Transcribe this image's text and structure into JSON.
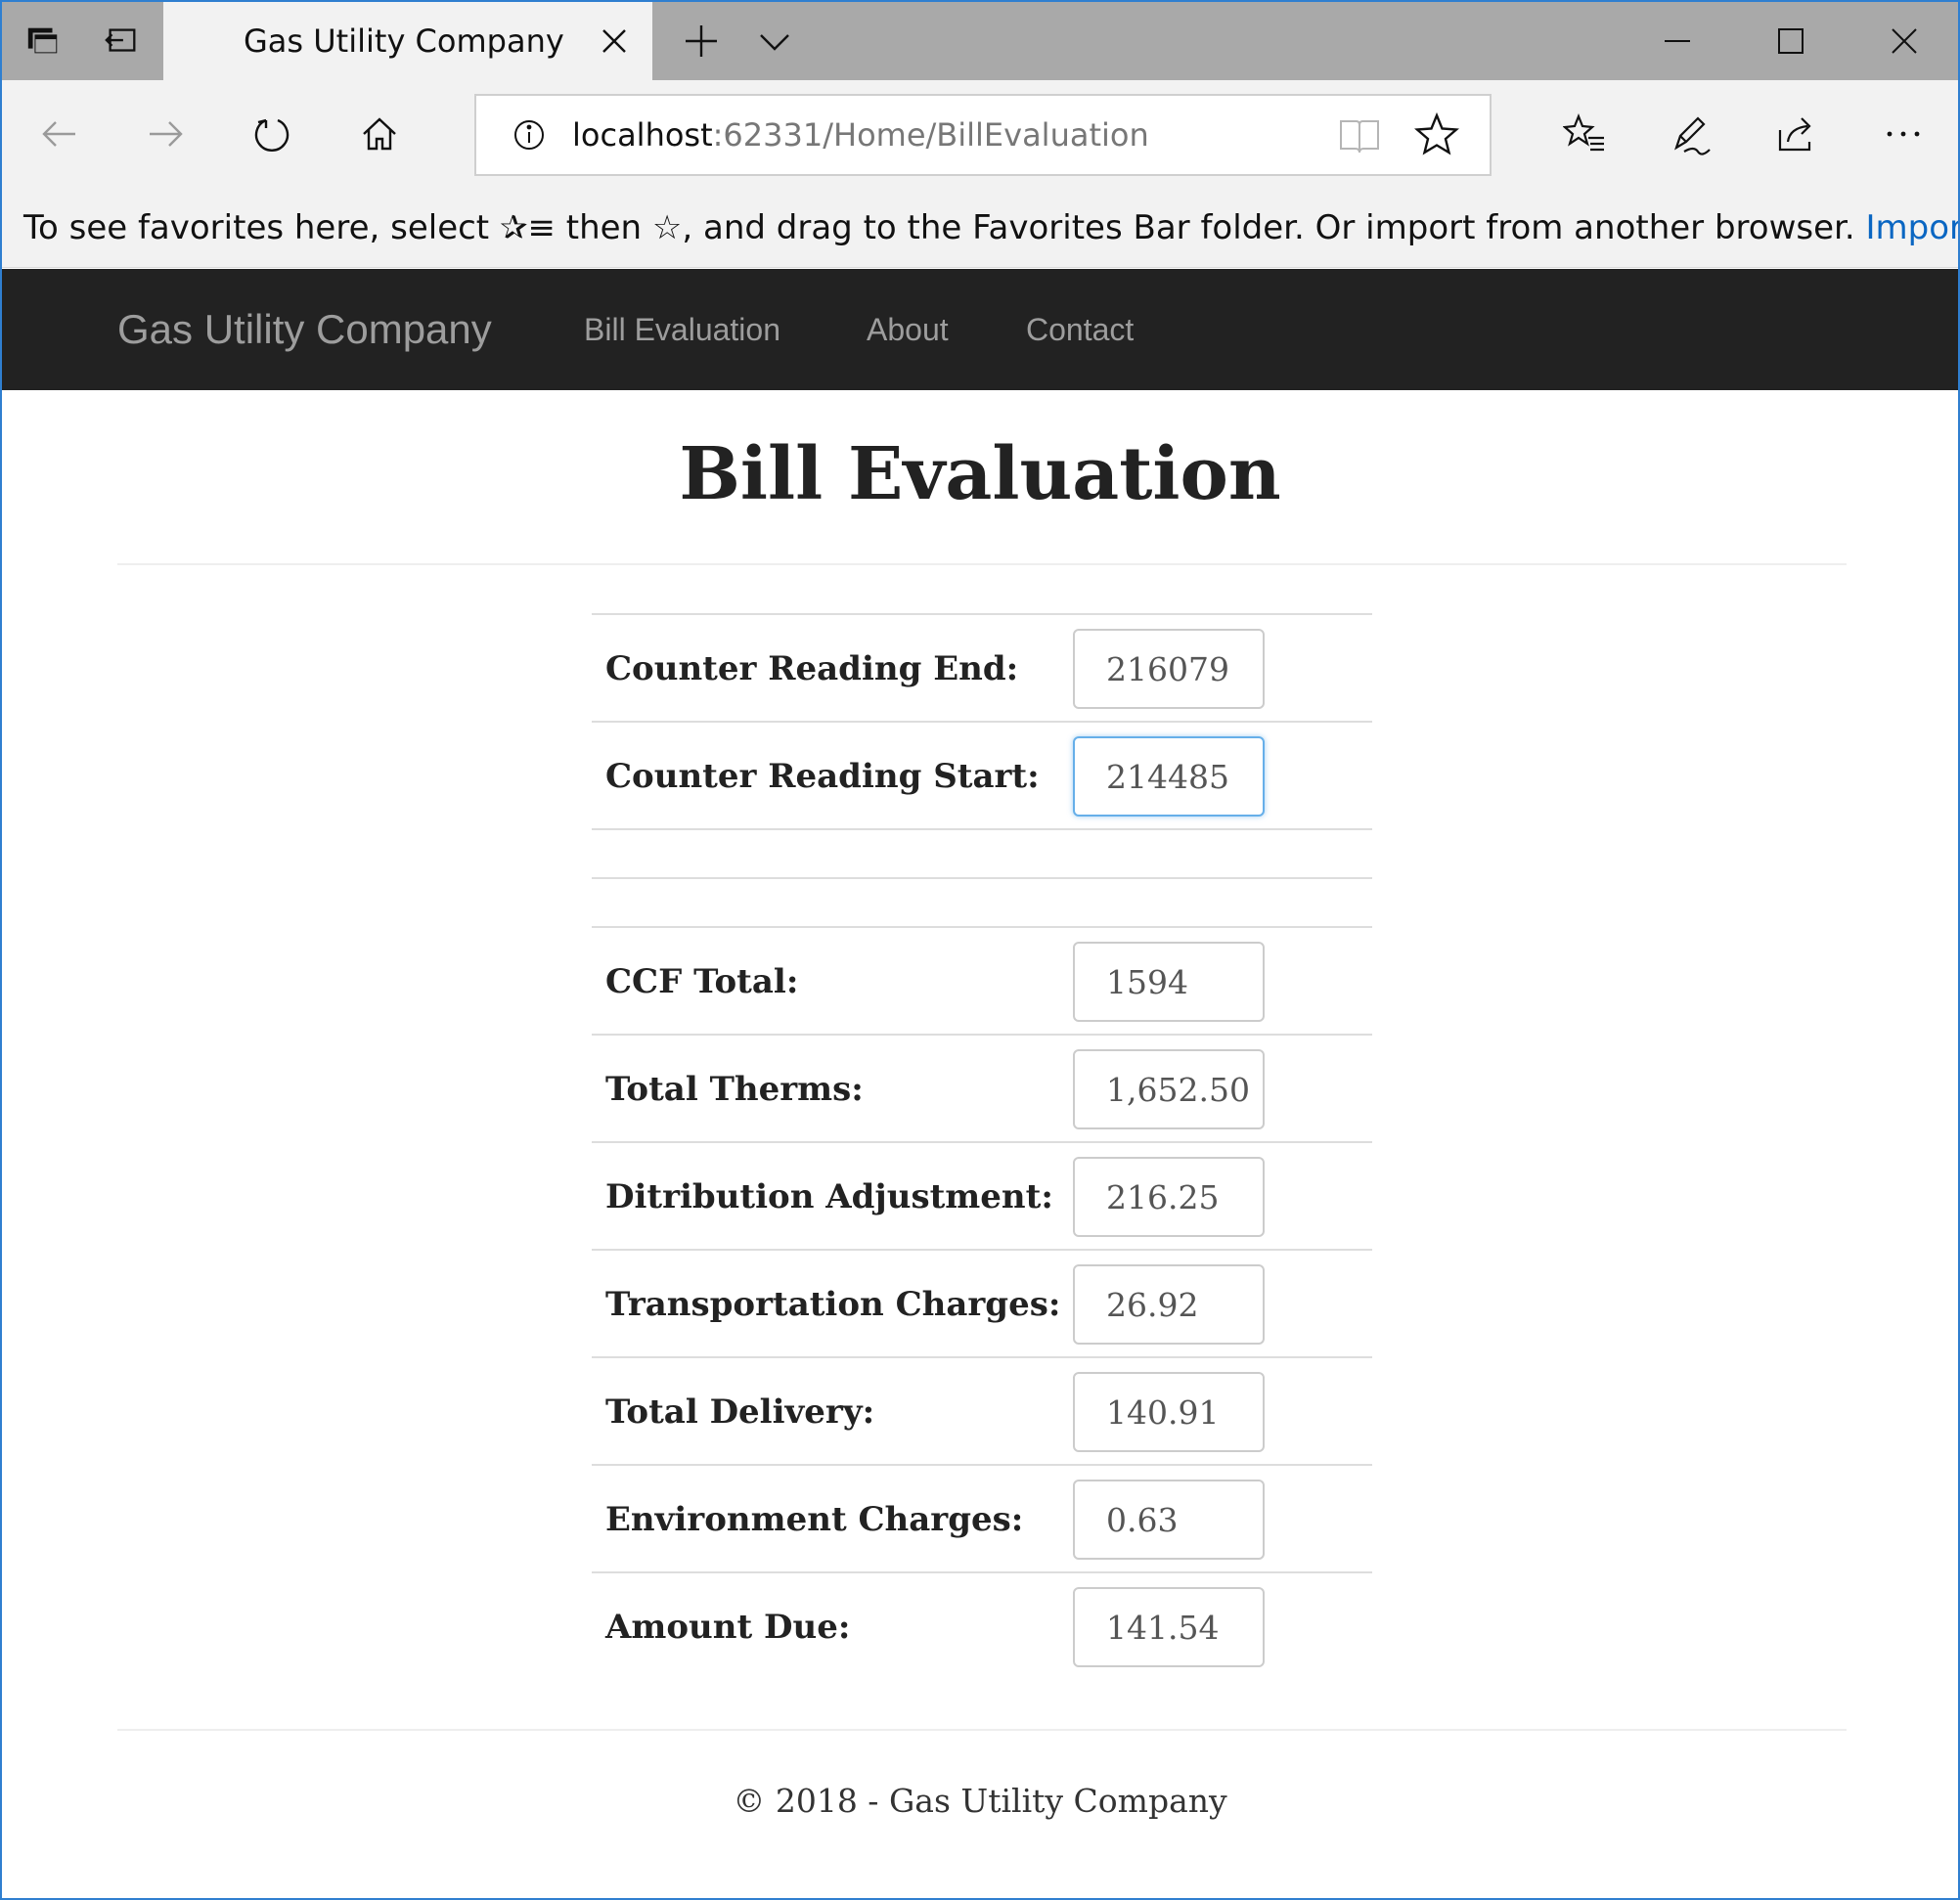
{
  "browser": {
    "tab_title": "Gas Utility Company :: B",
    "address": {
      "host": "localhost",
      "path": ":62331/Home/BillEvaluation"
    },
    "favorites_bar": {
      "text_part1": "To see favorites here, select ",
      "icon_glyph1": "✰≡",
      "text_part2": " then ",
      "icon_glyph2": "☆",
      "text_part3": ", and drag to the Favorites Bar folder. Or import from another browser. ",
      "link": "Import fav"
    }
  },
  "site": {
    "brand": "Gas Utility Company",
    "nav": [
      "Bill Evaluation",
      "About",
      "Contact"
    ]
  },
  "page": {
    "title": "Bill Evaluation",
    "inputs": [
      {
        "label": "Counter Reading End:",
        "value": "216079"
      },
      {
        "label": "Counter Reading Start:",
        "value": "214485"
      }
    ],
    "results": [
      {
        "label": "CCF Total:",
        "value": "1594"
      },
      {
        "label": "Total Therms:",
        "value": "1,652.50"
      },
      {
        "label": "Ditribution Adjustment:",
        "value": "216.25"
      },
      {
        "label": "Transportation Charges:",
        "value": "26.92"
      },
      {
        "label": "Total Delivery:",
        "value": "140.91"
      },
      {
        "label": "Environment Charges:",
        "value": "0.63"
      },
      {
        "label": "Amount Due:",
        "value": "141.54"
      }
    ],
    "footer": "© 2018 - Gas Utility Company"
  },
  "colors": {
    "navbar_bg": "#222222",
    "nav_text": "#9d9d9d",
    "link_blue": "#0a66c2",
    "focus_border": "#66afe9"
  }
}
